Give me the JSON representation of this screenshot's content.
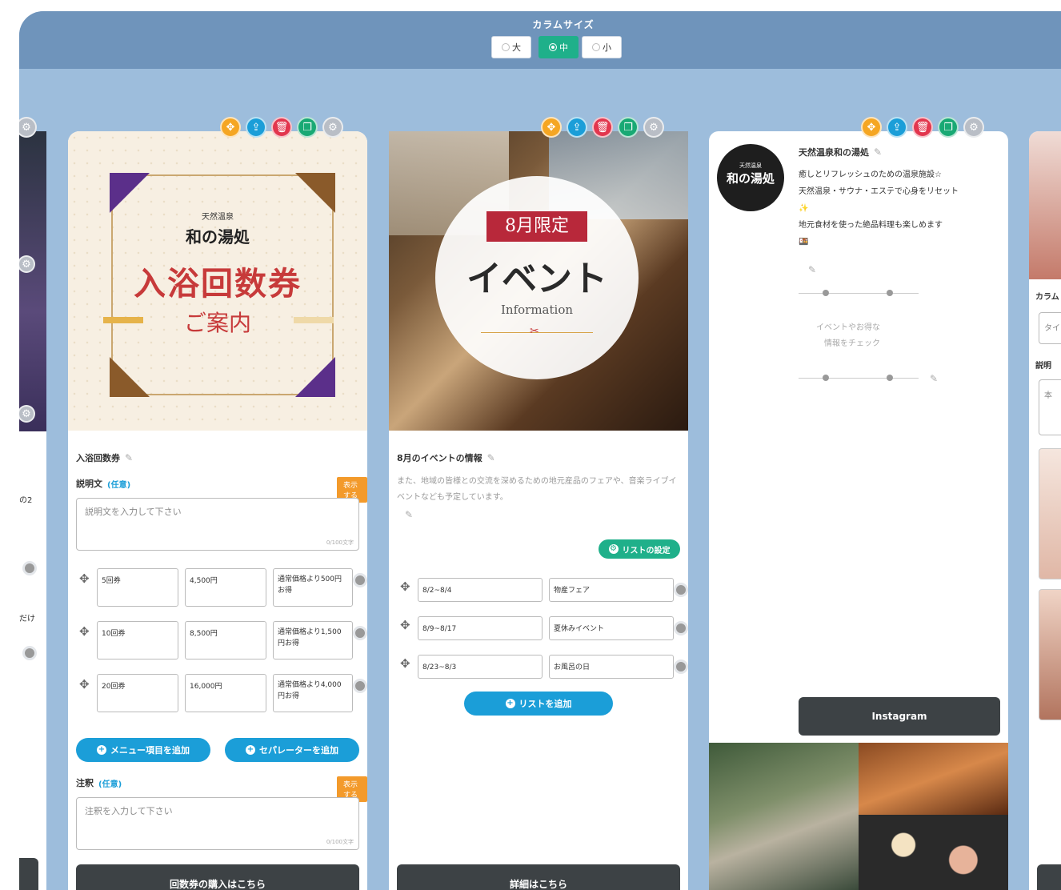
{
  "column_size": {
    "title": "カラムサイズ",
    "options": [
      {
        "label": "大",
        "selected": false
      },
      {
        "label": "中",
        "selected": true
      },
      {
        "label": "小",
        "selected": false
      }
    ]
  },
  "colors": {
    "accent_green": "#1fb08a",
    "accent_blue": "#1b9ed8",
    "required_orange": "#f39a2b",
    "frame_bg": "#9dbddc",
    "topbar_bg": "#6f94bb"
  },
  "left_partial": {
    "fragments": [
      "の2",
      "だけ"
    ]
  },
  "coupon_column": {
    "poster": {
      "brand_small": "天然温泉",
      "brand": "和の湯処",
      "heading": "入浴回数券",
      "subheading": "ご案内"
    },
    "title": "入浴回数券",
    "description_label": "説明文",
    "optional_tag": "(任意)",
    "required_tag": "表示する",
    "description_placeholder": "説明文を入力して下さい",
    "char_counter": "0/100文字",
    "rows": [
      {
        "name": "5回券",
        "price": "4,500円",
        "note": "通常価格より500円お得"
      },
      {
        "name": "10回券",
        "price": "8,500円",
        "note": "通常価格より1,500円お得"
      },
      {
        "name": "20回券",
        "price": "16,000円",
        "note": "通常価格より4,000円お得"
      }
    ],
    "add_menu_button": "メニュー項目を追加",
    "add_separator_button": "セパレーターを追加",
    "notes_label": "注釈",
    "notes_placeholder": "注釈を入力して下さい",
    "notes_counter": "0/100文字",
    "cta": "回数券の購入はこちら"
  },
  "event_column": {
    "poster": {
      "banner": "8月限定",
      "heading": "イベント",
      "subheading": "Information"
    },
    "title": "8月のイベントの情報",
    "description": "また、地域の皆様との交流を深めるための地元産品のフェアや、音楽ライブイベントなども予定しています。",
    "list_settings_button": "リストの設定",
    "rows": [
      {
        "date": "8/2~8/4",
        "event": "物産フェア"
      },
      {
        "date": "8/9~8/17",
        "event": "夏休みイベント"
      },
      {
        "date": "8/23~8/3",
        "event": "お風呂の日"
      }
    ],
    "add_list_button": "リストを追加",
    "cta": "詳細はこちら"
  },
  "profile_column": {
    "logo_small": "天然温泉",
    "logo_main": "和の湯処",
    "name": "天然温泉和の湯処",
    "lines": [
      "癒しとリフレッシュのための温泉施設☆",
      "天然温泉・サウナ・エステで心身をリセット",
      "✨",
      "地元食材を使った絶品料理も楽しめます",
      "🍱"
    ],
    "event_note_line1": "イベントやお得な",
    "event_note_line2": "情報をチェック",
    "cta": "Instagram"
  },
  "right_partial": {
    "label_fragment1": "カラム",
    "input_fragment": "タイ",
    "label_fragment2": "説明",
    "text_fragment": "本"
  }
}
